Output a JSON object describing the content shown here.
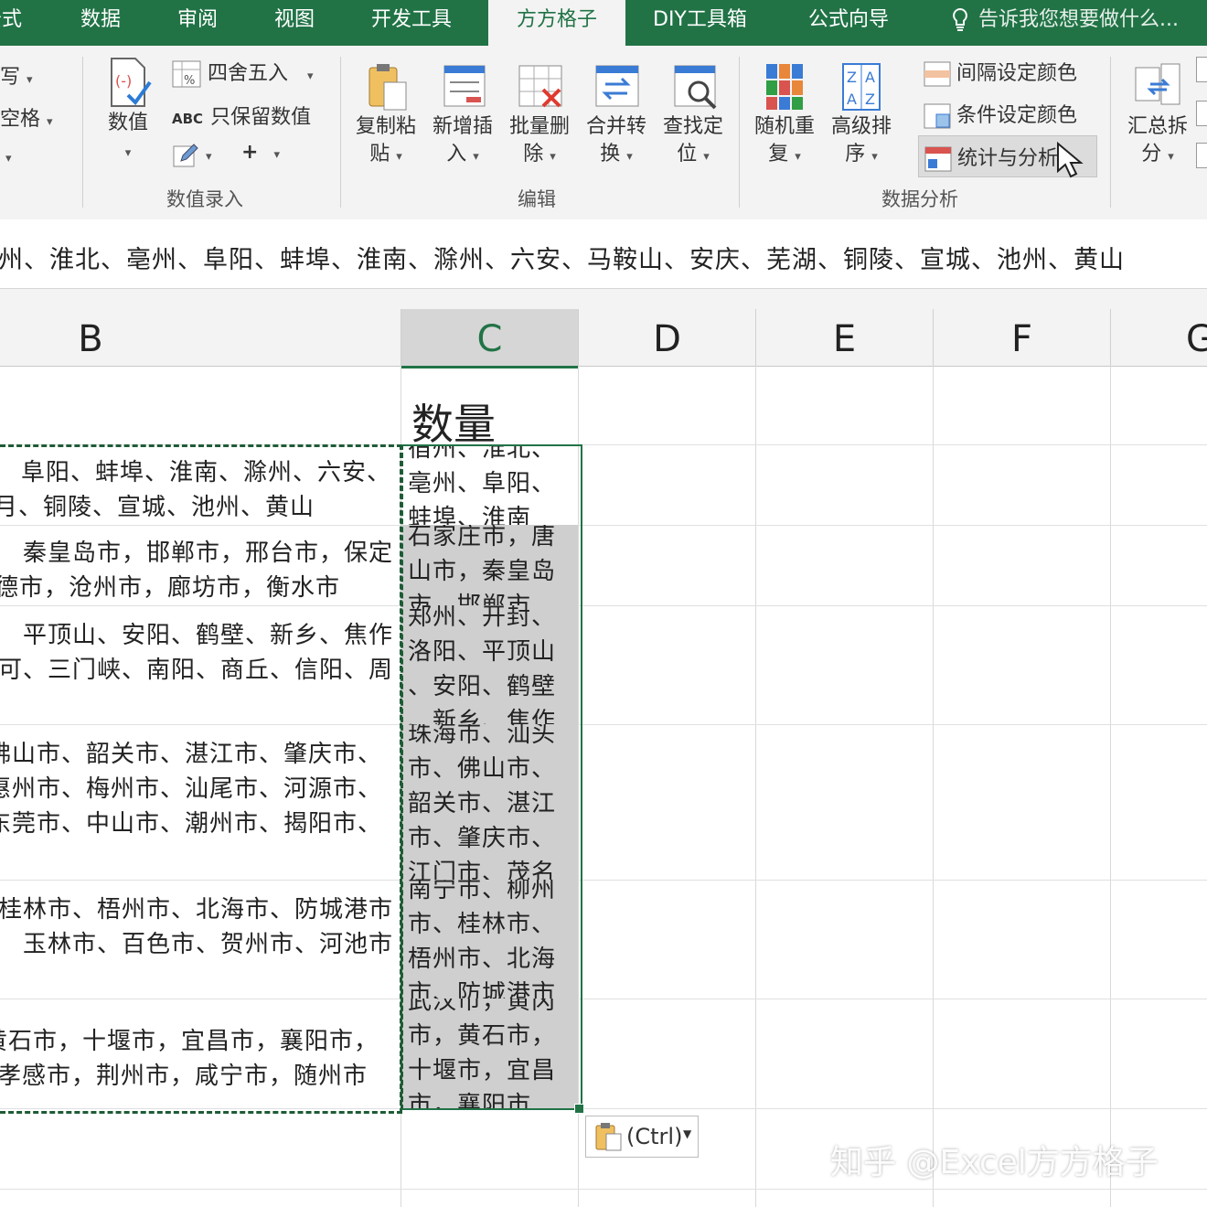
{
  "tabs": {
    "items": [
      "公式",
      "数据",
      "审阅",
      "视图",
      "开发工具",
      "方方格子",
      "DIY工具箱",
      "公式向导"
    ],
    "tell_me": "告诉我您想要做什么..."
  },
  "ribbon": {
    "left_partial": {
      "r1": "写",
      "r2": "空格",
      "r3": ""
    },
    "numeric_entry": {
      "value_button": "数值",
      "round_label": "四舍五入",
      "keep_value_label": "只保留数值",
      "abc": "ABC",
      "plus": "+",
      "group_label": "数值录入"
    },
    "edit_group": {
      "buttons": [
        {
          "l1": "复制粘",
          "l2": "贴"
        },
        {
          "l1": "新增插",
          "l2": "入"
        },
        {
          "l1": "批量删",
          "l2": "除"
        },
        {
          "l1": "合并转",
          "l2": "换"
        },
        {
          "l1": "查找定",
          "l2": "位"
        }
      ],
      "group_label": "编辑"
    },
    "analysis_group": {
      "buttons": [
        {
          "l1": "随机重",
          "l2": "复"
        },
        {
          "l1": "高级排",
          "l2": "序"
        }
      ],
      "interval_color": "间隔设定颜色",
      "condition_color": "条件设定颜色",
      "stats_analysis": "统计与分析",
      "group_label": "数据分析"
    },
    "right_partial": {
      "l1": "汇总拆",
      "l2": "分"
    }
  },
  "formula_bar": {
    "text": "宿州、淮北、亳州、阜阳、蚌埠、淮南、滁州、六安、马鞍山、安庆、芜湖、铜陵、宣城、池州、黄山"
  },
  "columns": [
    "B",
    "C",
    "D",
    "E",
    "F",
    "G"
  ],
  "column_c_header": "数量",
  "column_b_rows": [
    [
      "阜阳、蚌埠、淮南、滁州、六安、",
      "月、铜陵、宣城、池州、黄山"
    ],
    [
      "秦皇岛市，邯郸市，邢台市，保定",
      "德市，沧州市，廊坊市，衡水市"
    ],
    [
      "平顶山、安阳、鹤壁、新乡、焦作",
      "可、三门峡、南阳、商丘、信阳、周"
    ],
    [
      "佛山市、韶关市、湛江市、肇庆市、",
      "惠州市、梅州市、汕尾市、河源市、",
      "东莞市、中山市、潮州市、揭阳市、"
    ],
    [
      "桂林市、梧州市、北海市、防城港市",
      "玉林市、百色市、贺州市、河池市"
    ],
    [
      "黄石市，十堰市，宜昌市，襄阳市，",
      "孝感市，荆州市，咸宁市，随州市"
    ]
  ],
  "column_c_rows": [
    [
      "宿州、淮北、",
      "亳州、阜阳、",
      "蚌埠、淮南"
    ],
    [
      "石家庄市，唐",
      "山市，秦皇岛",
      "市，邯郸市"
    ],
    [
      "郑州、开封、",
      "洛阳、平顶山",
      "、安阳、鹤壁",
      "、新乡、焦作"
    ],
    [
      "珠海市、汕头",
      "市、佛山市、",
      "韶关市、湛江",
      "市、肇庆市、",
      "江门市、茂名"
    ],
    [
      "南宁市、柳州",
      "市、桂林市、",
      "梧州市、北海",
      "市、防城港市"
    ],
    [
      "武汉市，黄冈",
      "市，黄石市，",
      "十堰市，宜昌",
      "市，襄阳市"
    ]
  ],
  "paste_options": "(Ctrl)",
  "watermark": "知乎 @Excel方方格子",
  "colors": {
    "accent": "#217346",
    "selection_fill": "#cfcfcf",
    "ribbon_bg": "#f3f3f3"
  }
}
